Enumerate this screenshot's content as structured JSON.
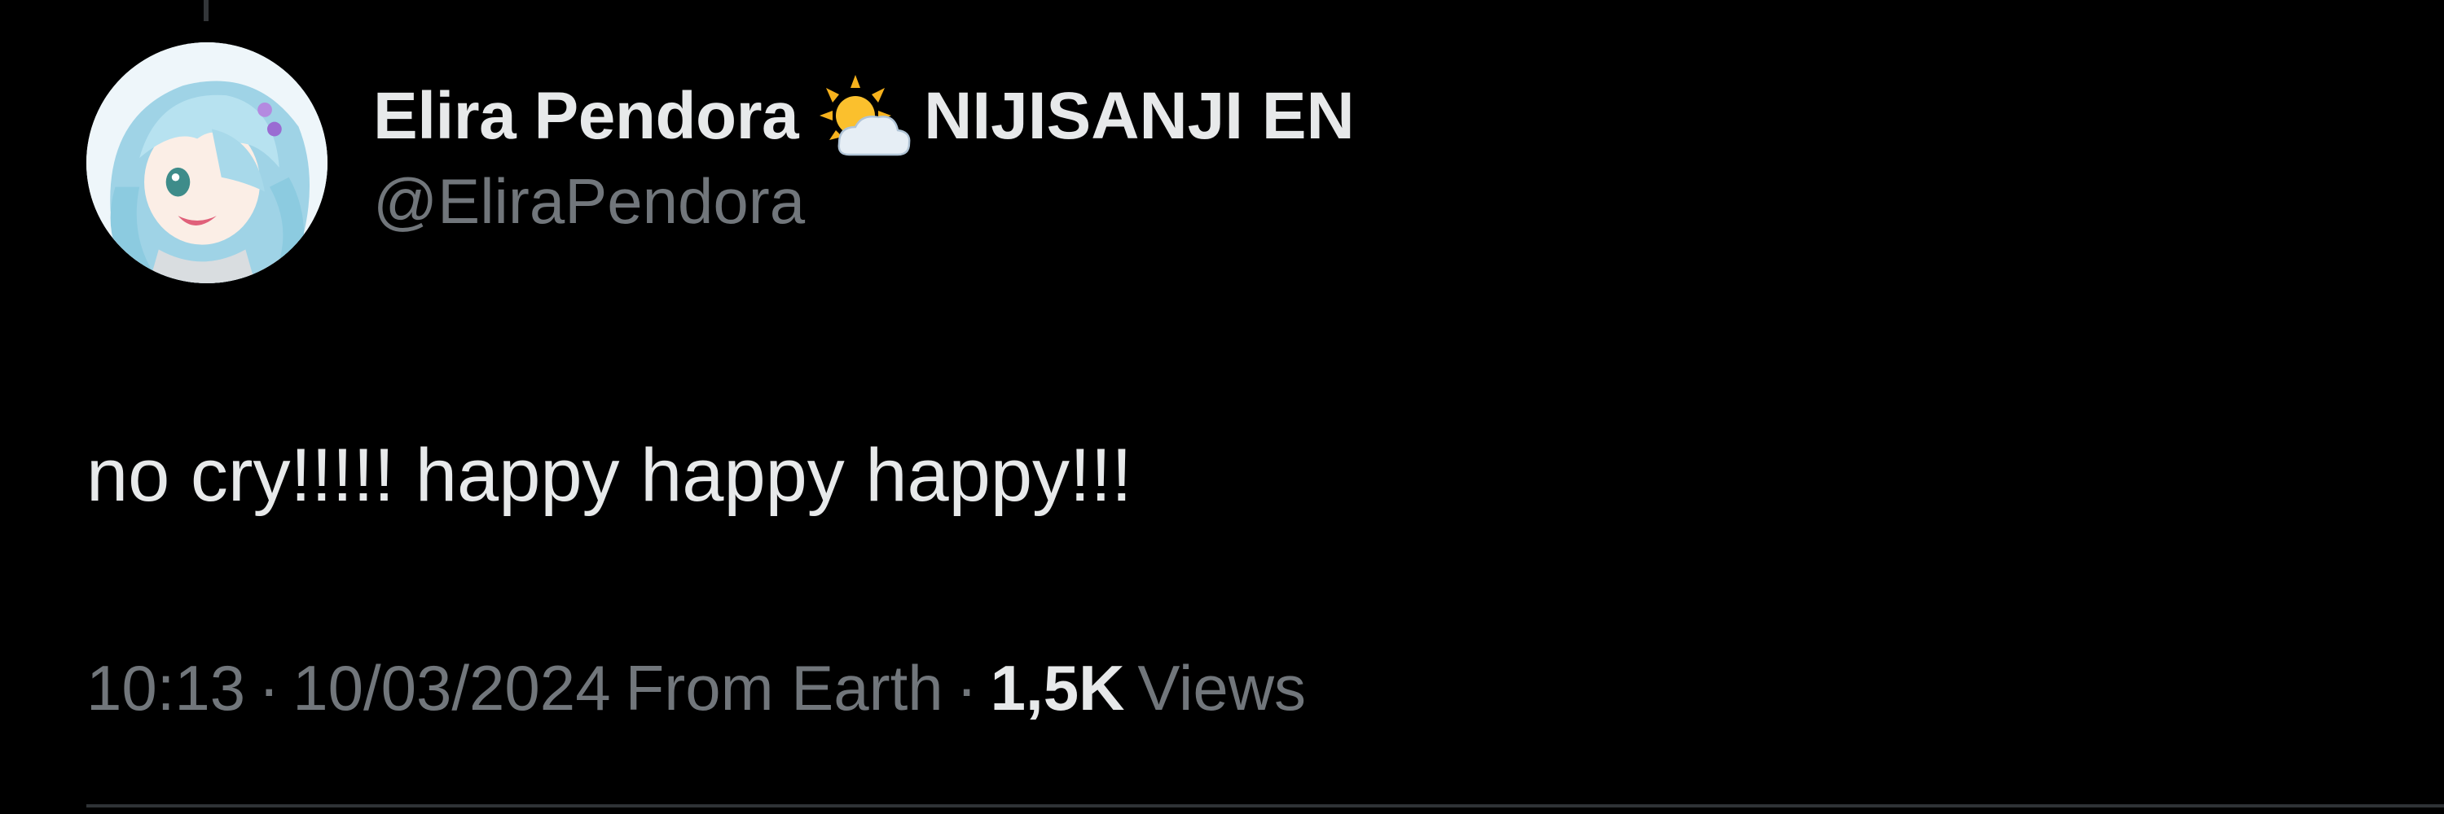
{
  "author": {
    "display_name": "Elira Pendora",
    "badge_icon": "sun-behind-cloud-icon",
    "affiliation": "NIJISANJI EN",
    "handle": "@EliraPendora",
    "avatar_icon": "avatar-image"
  },
  "tweet": {
    "text": "no cry!!!!! happy happy happy!!!"
  },
  "meta": {
    "time": "10:13",
    "date": "10/03/2024",
    "source": "From Earth",
    "separator": "·",
    "views_count": "1,5K",
    "views_label": "Views"
  },
  "colors": {
    "background": "#000000",
    "primary_text": "#e7e9ea",
    "secondary_text": "#71767b",
    "divider": "#2f3336"
  }
}
